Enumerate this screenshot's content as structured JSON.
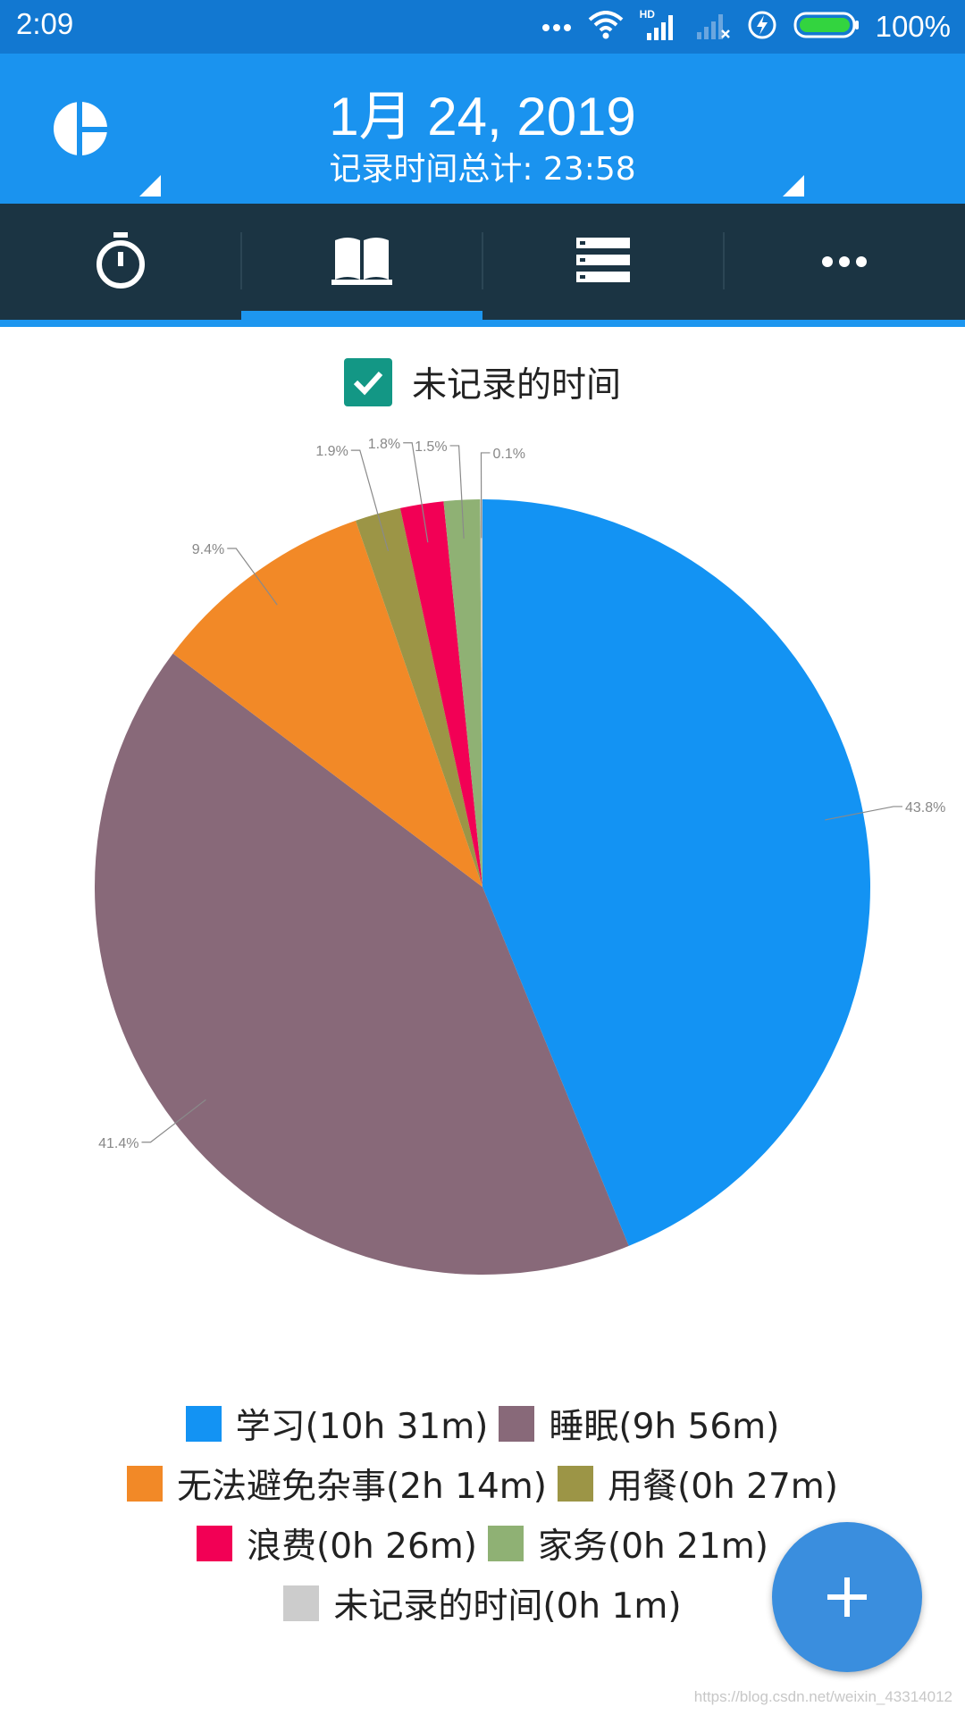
{
  "status_bar": {
    "time": "2:09",
    "network": "HD",
    "battery_percent": "100%",
    "icons": [
      "more-dots-icon",
      "wifi-icon",
      "signal-hd-icon",
      "signal-empty-icon",
      "charging-icon",
      "battery-icon"
    ]
  },
  "header": {
    "date_title": "1月 24, 2019",
    "subtitle": "记录时间总计: 23:58",
    "app_icon": "pie-chart-icon",
    "background_color": "#1a93ef"
  },
  "tabs": [
    {
      "name": "timer",
      "icon": "stopwatch-icon",
      "selected": false
    },
    {
      "name": "book",
      "icon": "book-icon",
      "selected": true
    },
    {
      "name": "list",
      "icon": "list-icon",
      "selected": false
    },
    {
      "name": "more",
      "icon": "more-icon",
      "selected": false
    }
  ],
  "toggle": {
    "label": "未记录的时间",
    "checked": true,
    "color": "#139785"
  },
  "chart_data": {
    "type": "pie",
    "slices": [
      {
        "label": "学习",
        "value_text": "10h 31m",
        "minutes": 631,
        "percent": 43.8,
        "percent_label": "43.8%",
        "color": "#1393f3"
      },
      {
        "label": "睡眠",
        "value_text": "9h 56m",
        "minutes": 596,
        "percent": 41.4,
        "percent_label": "41.4%",
        "color": "#886979"
      },
      {
        "label": "无法避免杂事",
        "value_text": "2h 14m",
        "minutes": 134,
        "percent": 9.4,
        "percent_label": "9.4%",
        "color": "#f28927"
      },
      {
        "label": "用餐",
        "value_text": "0h 27m",
        "minutes": 27,
        "percent": 1.9,
        "percent_label": "1.9%",
        "color": "#9c9546"
      },
      {
        "label": "浪费",
        "value_text": "0h 26m",
        "minutes": 26,
        "percent": 1.8,
        "percent_label": "1.8%",
        "color": "#f20055"
      },
      {
        "label": "家务",
        "value_text": "0h 21m",
        "minutes": 21,
        "percent": 1.5,
        "percent_label": "1.5%",
        "color": "#8fb174"
      },
      {
        "label": "未记录的时间",
        "value_text": "0h 1m",
        "minutes": 1,
        "percent": 0.1,
        "percent_label": "0.1%",
        "color": "#cccccc"
      }
    ],
    "legend_rows": [
      [
        0,
        1
      ],
      [
        2,
        3
      ],
      [
        4,
        5
      ],
      [
        6
      ]
    ],
    "legend_placement": "bottom",
    "start": "12 o'clock",
    "direction": "clockwise"
  },
  "fab": {
    "icon": "plus-icon",
    "color": "#3a8ede"
  },
  "watermark": "https://blog.csdn.net/weixin_43314012"
}
